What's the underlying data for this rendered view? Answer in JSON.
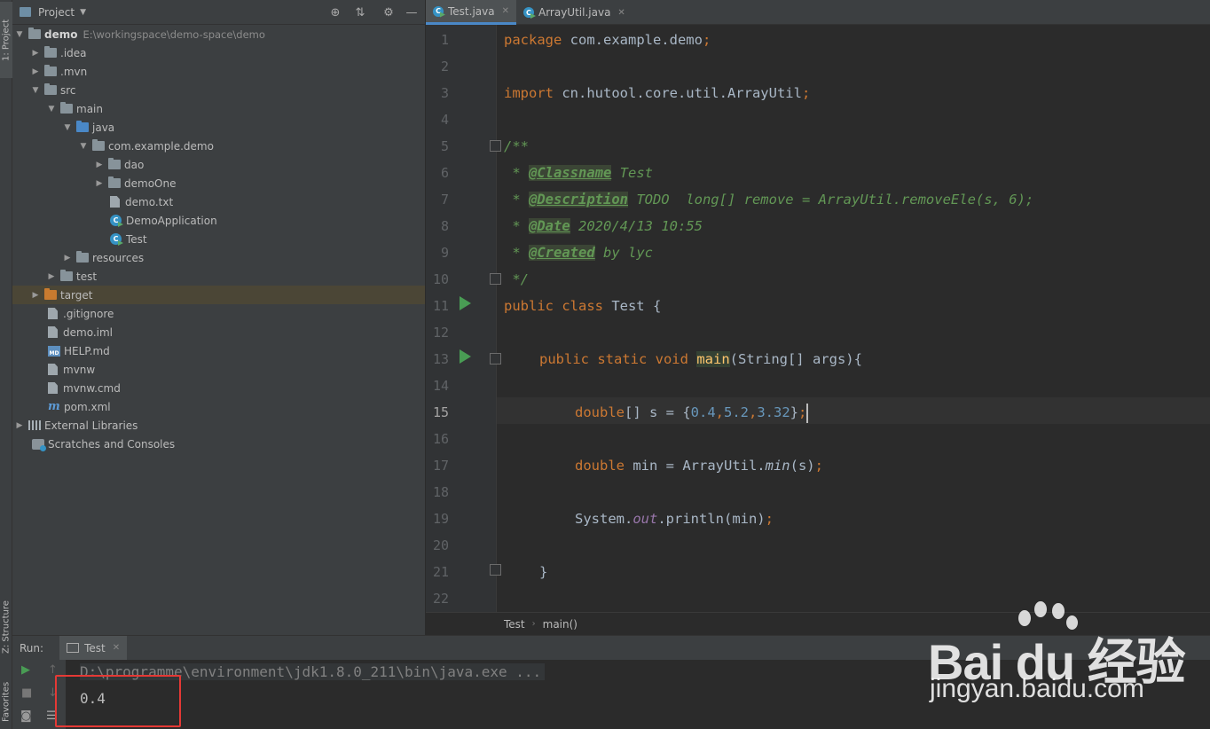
{
  "sidebar": {
    "project_tab": "1: Project",
    "structure_tab": "Z: Structure",
    "favorites_tab": "Favorites"
  },
  "project": {
    "title": "Project",
    "tree": [
      {
        "label": "demo",
        "path": "E:\\workingspace\\demo-space\\demo"
      },
      {
        "label": ".idea"
      },
      {
        "label": ".mvn"
      },
      {
        "label": "src"
      },
      {
        "label": "main"
      },
      {
        "label": "java"
      },
      {
        "label": "com.example.demo"
      },
      {
        "label": "dao"
      },
      {
        "label": "demoOne"
      },
      {
        "label": "demo.txt"
      },
      {
        "label": "DemoApplication"
      },
      {
        "label": "Test"
      },
      {
        "label": "resources"
      },
      {
        "label": "test"
      },
      {
        "label": "target"
      },
      {
        "label": ".gitignore"
      },
      {
        "label": "demo.iml"
      },
      {
        "label": "HELP.md"
      },
      {
        "label": "mvnw"
      },
      {
        "label": "mvnw.cmd"
      },
      {
        "label": "pom.xml"
      },
      {
        "label": "External Libraries"
      },
      {
        "label": "Scratches and Consoles"
      }
    ]
  },
  "editor": {
    "tabs": [
      {
        "label": "Test.java"
      },
      {
        "label": "ArrayUtil.java"
      }
    ],
    "current_line": "15",
    "line_numbers": [
      "1",
      "2",
      "3",
      "4",
      "5",
      "6",
      "7",
      "8",
      "9",
      "10",
      "11",
      "12",
      "13",
      "14",
      "15",
      "16",
      "17",
      "18",
      "19",
      "20",
      "21",
      "22"
    ],
    "code": {
      "l1_kw": "package",
      "l1_rest": " com.example.demo",
      "l1_semi": ";",
      "l3_kw": "import",
      "l3_rest": " cn.hutool.core.util.ArrayUtil",
      "l3_semi": ";",
      "l5": "/**",
      "l6_pre": " * ",
      "l6_tag": "@Classname",
      "l6_rest": " Test",
      "l7_pre": " * ",
      "l7_tag": "@Description",
      "l7_rest": " TODO  long[] remove = ArrayUtil.removeEle(s, 6);",
      "l8_pre": " * ",
      "l8_tag": "@Date",
      "l8_rest": " 2020/4/13 10:55",
      "l9_pre": " * ",
      "l9_tag": "@Created",
      "l9_rest": " by lyc",
      "l10": " */",
      "l11_kw": "public class",
      "l11_rest": " Test {",
      "l13_kw": "public static void",
      "l13_fn": "main",
      "l13_rest": "(String[] args){",
      "l15_kw": "double",
      "l15_rest": "[] s = {",
      "l15_n1": "0.4",
      "l15_c1": ",",
      "l15_n2": "5.2",
      "l15_c2": ",",
      "l15_n3": "3.32",
      "l15_end": "}",
      "l15_semi": ";",
      "l17_kw": "double",
      "l17_rest": " min = ArrayUtil.",
      "l17_fn": "min",
      "l17_end": "(s)",
      "l17_semi": ";",
      "l19_pre": "System.",
      "l19_out": "out",
      "l19_rest": ".println(min)",
      "l19_semi": ";",
      "l21": "}"
    }
  },
  "breadcrumb": {
    "class": "Test",
    "method": "main()"
  },
  "run": {
    "label": "Run:",
    "tab": "Test",
    "command": "D:\\programme\\environment\\jdk1.8.0_211\\bin\\java.exe ...",
    "output": "0.4"
  },
  "watermark": {
    "brand": "Bai du 经验",
    "url": "jingyan.baidu.com"
  },
  "colors": {
    "keyword": "#cc7832",
    "number": "#6897bb",
    "doc_comment": "#629755",
    "method": "#ffc66d",
    "static_field": "#9876aa",
    "highlight_box": "#e53935",
    "run_green": "#499c54"
  }
}
